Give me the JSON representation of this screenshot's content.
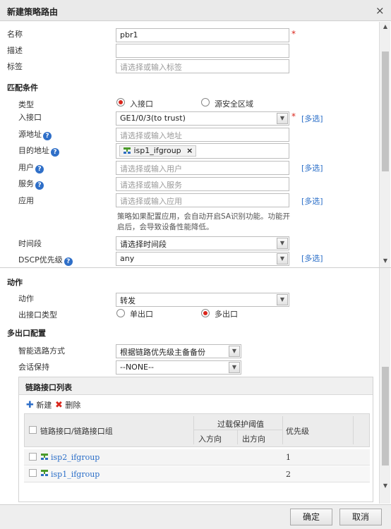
{
  "dialog": {
    "title": "新建策略路由",
    "close_glyph": "×"
  },
  "basic": {
    "name_label": "名称",
    "name_value": "pbr1",
    "desc_label": "描述",
    "desc_value": "",
    "tag_label": "标签",
    "tag_placeholder": "请选择或输入标签"
  },
  "match": {
    "section": "匹配条件",
    "type_label": "类型",
    "type_opt1": "入接口",
    "type_opt2": "源安全区域",
    "type_selected": "入接口",
    "in_if_label": "入接口",
    "in_if_value": "GE1/0/3(to trust)",
    "multi_select": "[多选]",
    "src_label": "源地址",
    "src_placeholder": "请选择或输入地址",
    "dst_label": "目的地址",
    "dst_tag": "isp1_ifgroup",
    "tag_remove": "×",
    "user_label": "用户",
    "user_placeholder": "请选择或输入用户",
    "service_label": "服务",
    "service_placeholder": "请选择或输入服务",
    "app_label": "应用",
    "app_placeholder": "请选择或输入应用",
    "app_note": "策略如果配置应用，会自动开启SA识别功能。功能开启后，会导致设备性能降低。",
    "time_label": "时间段",
    "time_placeholder": "请选择时间段",
    "dscp_label": "DSCP优先级",
    "dscp_value": "any",
    "help_glyph": "?"
  },
  "action": {
    "section": "动作",
    "action_label": "动作",
    "action_value": "转发",
    "out_type_label": "出接口类型",
    "out_opt1": "单出口",
    "out_opt2": "多出口",
    "out_selected": "多出口"
  },
  "multi": {
    "section": "多出口配置",
    "smart_label": "智能选路方式",
    "smart_value": "根据链路优先级主备备份",
    "session_label": "会话保持",
    "session_value": "--NONE--"
  },
  "link_table": {
    "title": "链路接口列表",
    "new_label": "新建",
    "delete_label": "删除",
    "col_if": "链路接口/链路接口组",
    "col_overload": "过载保护阈值",
    "col_in": "入方向",
    "col_out": "出方向",
    "col_priority": "优先级",
    "rows": [
      {
        "name": "isp2_ifgroup",
        "priority": "1"
      },
      {
        "name": "isp1_ifgroup",
        "priority": "2"
      }
    ]
  },
  "footer": {
    "ok": "确定",
    "cancel": "取消"
  },
  "colors": {
    "required": "#d9261c",
    "link": "#2a6ec8",
    "help": "#2f6fc8"
  }
}
